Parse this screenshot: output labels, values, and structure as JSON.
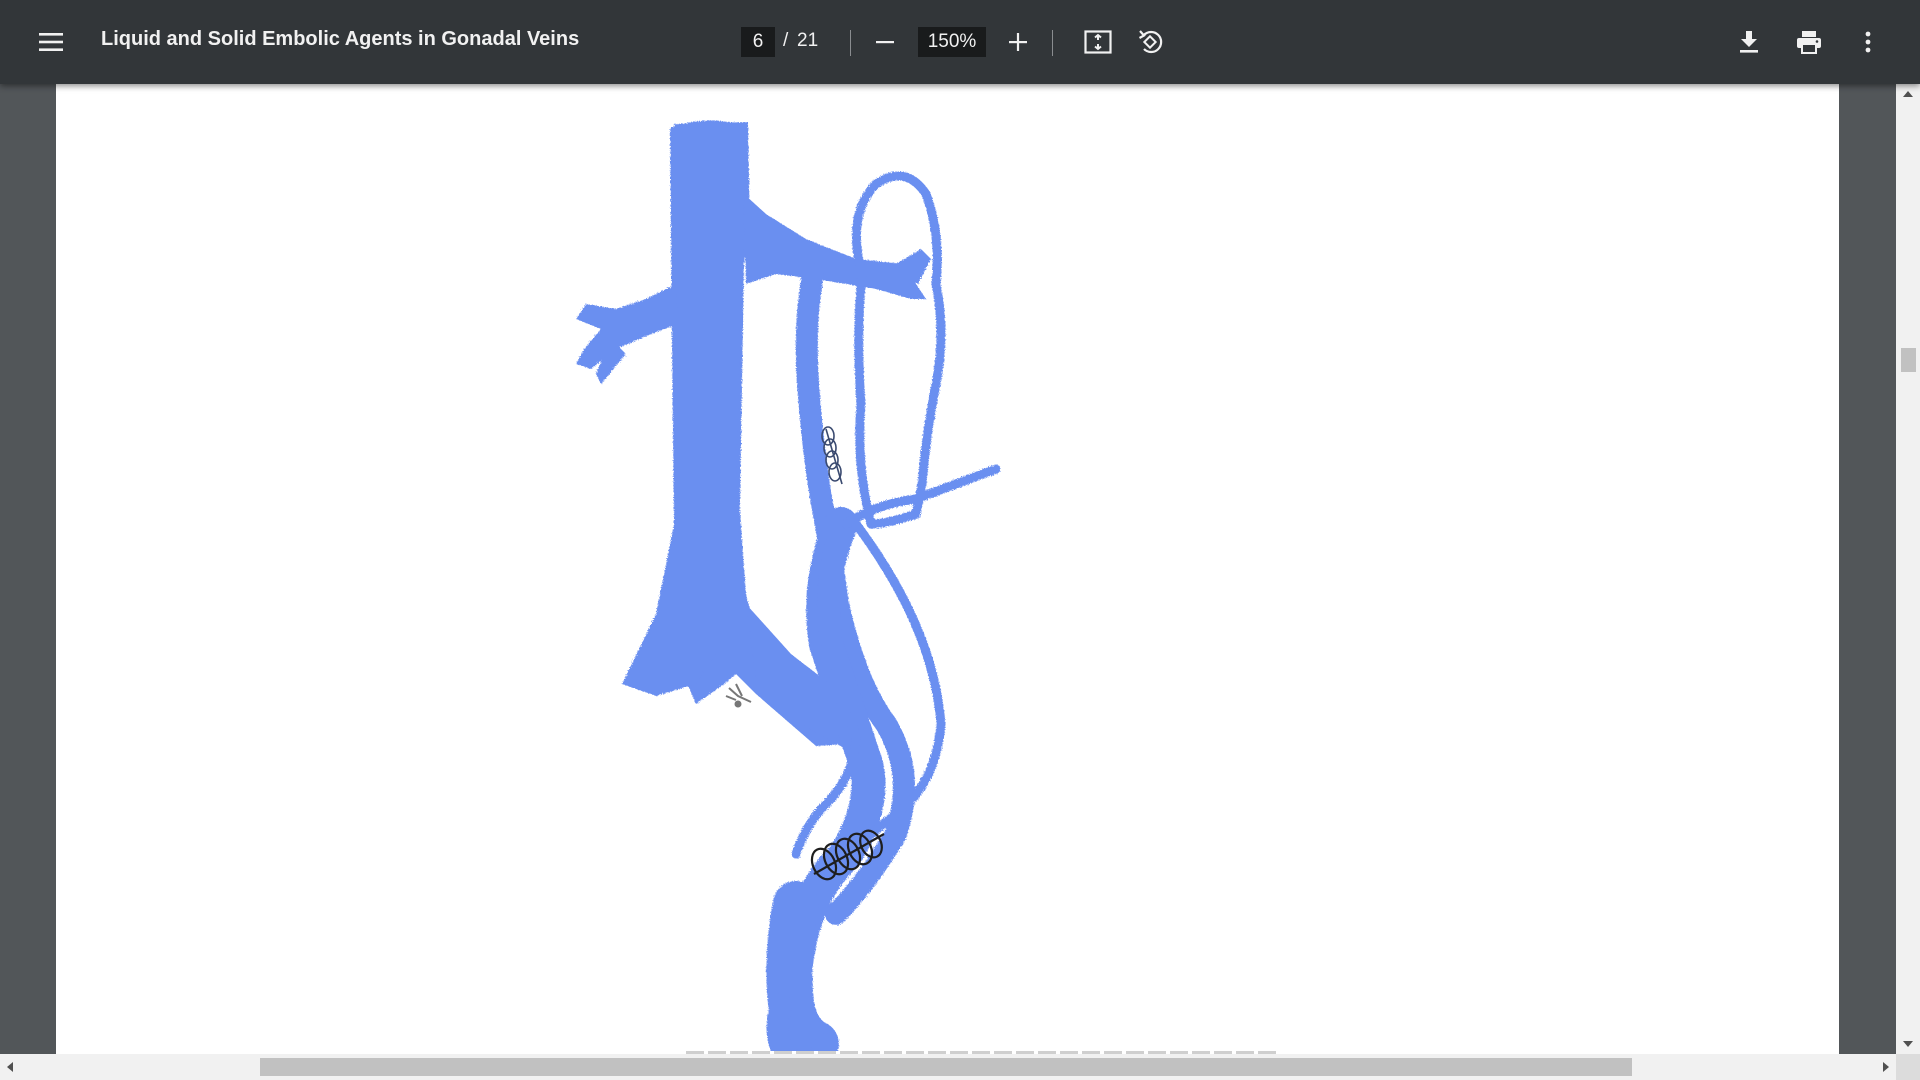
{
  "toolbar": {
    "menu_icon": "hamburger-menu-icon",
    "title": "Liquid and Solid Embolic Agents in Gonadal Veins",
    "current_page": "6",
    "page_separator": "/",
    "total_pages": "21",
    "zoom_out_icon": "minus-icon",
    "zoom_level": "150%",
    "zoom_in_icon": "plus-icon",
    "fit_icon": "fit-to-page-icon",
    "rotate_icon": "rotate-counterclockwise-icon",
    "download_icon": "download-icon",
    "print_icon": "print-icon",
    "more_icon": "more-vertical-icon"
  },
  "document": {
    "figure_image": "hand-drawn venous anatomy illustration with coils"
  },
  "colors": {
    "toolbar_bg": "#323639",
    "viewer_bg": "#525659",
    "vein_blue": "#6b8ff0",
    "page_bg": "#ffffff"
  }
}
